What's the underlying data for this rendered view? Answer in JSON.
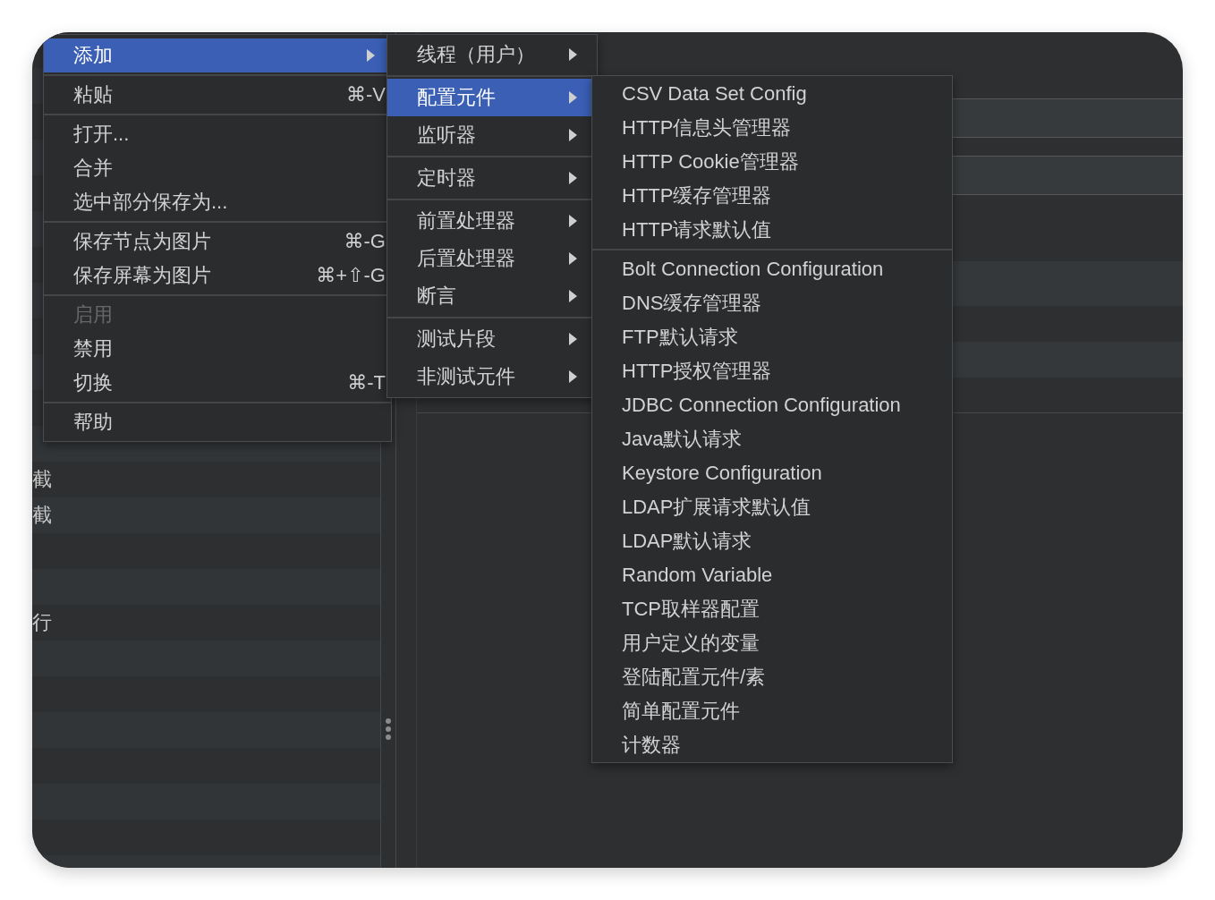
{
  "tree": {
    "items": [
      {
        "label": "截"
      },
      {
        "label": "截"
      },
      {
        "label": "行"
      }
    ]
  },
  "context_menu": {
    "items": [
      {
        "kind": "item",
        "label": "添加",
        "submenu": true,
        "selected": true,
        "disabled": false
      },
      {
        "kind": "separator"
      },
      {
        "kind": "item",
        "label": "粘贴",
        "shortcut": "⌘-V",
        "submenu": false,
        "selected": false,
        "disabled": false
      },
      {
        "kind": "separator"
      },
      {
        "kind": "item",
        "label": "打开...",
        "submenu": false,
        "selected": false,
        "disabled": false
      },
      {
        "kind": "item",
        "label": "合并",
        "submenu": false,
        "selected": false,
        "disabled": false
      },
      {
        "kind": "item",
        "label": "选中部分保存为...",
        "submenu": false,
        "selected": false,
        "disabled": false
      },
      {
        "kind": "separator"
      },
      {
        "kind": "item",
        "label": "保存节点为图片",
        "shortcut": "⌘-G",
        "submenu": false,
        "selected": false,
        "disabled": false
      },
      {
        "kind": "item",
        "label": "保存屏幕为图片",
        "shortcut": "⌘+⇧-G",
        "submenu": false,
        "selected": false,
        "disabled": false
      },
      {
        "kind": "separator"
      },
      {
        "kind": "item",
        "label": "启用",
        "submenu": false,
        "selected": false,
        "disabled": true
      },
      {
        "kind": "item",
        "label": "禁用",
        "submenu": false,
        "selected": false,
        "disabled": false
      },
      {
        "kind": "item",
        "label": "切换",
        "shortcut": "⌘-T",
        "submenu": false,
        "selected": false,
        "disabled": false
      },
      {
        "kind": "separator"
      },
      {
        "kind": "item",
        "label": "帮助",
        "submenu": false,
        "selected": false,
        "disabled": false
      }
    ]
  },
  "add_submenu": {
    "items": [
      {
        "kind": "item",
        "label": "线程（用户）",
        "submenu": true,
        "selected": false
      },
      {
        "kind": "separator"
      },
      {
        "kind": "item",
        "label": "配置元件",
        "submenu": true,
        "selected": true
      },
      {
        "kind": "item",
        "label": "监听器",
        "submenu": true,
        "selected": false
      },
      {
        "kind": "separator"
      },
      {
        "kind": "item",
        "label": "定时器",
        "submenu": true,
        "selected": false
      },
      {
        "kind": "separator"
      },
      {
        "kind": "item",
        "label": "前置处理器",
        "submenu": true,
        "selected": false
      },
      {
        "kind": "item",
        "label": "后置处理器",
        "submenu": true,
        "selected": false
      },
      {
        "kind": "item",
        "label": "断言",
        "submenu": true,
        "selected": false
      },
      {
        "kind": "separator"
      },
      {
        "kind": "item",
        "label": "测试片段",
        "submenu": true,
        "selected": false
      },
      {
        "kind": "item",
        "label": "非测试元件",
        "submenu": true,
        "selected": false
      }
    ]
  },
  "config_submenu": {
    "items": [
      {
        "kind": "item",
        "label": "CSV Data Set Config",
        "selected": false
      },
      {
        "kind": "item",
        "label": "HTTP信息头管理器",
        "selected": false
      },
      {
        "kind": "item",
        "label": "HTTP Cookie管理器",
        "selected": false
      },
      {
        "kind": "item",
        "label": "HTTP缓存管理器",
        "selected": false
      },
      {
        "kind": "item",
        "label": "HTTP请求默认值",
        "selected": false
      },
      {
        "kind": "separator"
      },
      {
        "kind": "item",
        "label": "Bolt Connection Configuration",
        "selected": false
      },
      {
        "kind": "item",
        "label": "DNS缓存管理器",
        "selected": false
      },
      {
        "kind": "item",
        "label": "FTP默认请求",
        "selected": false
      },
      {
        "kind": "item",
        "label": "HTTP授权管理器",
        "selected": false
      },
      {
        "kind": "item",
        "label": "JDBC Connection Configuration",
        "selected": false
      },
      {
        "kind": "item",
        "label": "Java默认请求",
        "selected": false
      },
      {
        "kind": "item",
        "label": "Keystore Configuration",
        "selected": false
      },
      {
        "kind": "item",
        "label": "LDAP扩展请求默认值",
        "selected": false
      },
      {
        "kind": "item",
        "label": "LDAP默认请求",
        "selected": false
      },
      {
        "kind": "item",
        "label": "Random Variable",
        "selected": false
      },
      {
        "kind": "item",
        "label": "TCP取样器配置",
        "selected": false
      },
      {
        "kind": "item",
        "label": "用户定义的变量",
        "selected": false
      },
      {
        "kind": "item",
        "label": "登陆配置元件/素",
        "selected": false
      },
      {
        "kind": "item",
        "label": "简单配置元件",
        "selected": false
      },
      {
        "kind": "item",
        "label": "计数器",
        "selected": false
      }
    ]
  }
}
